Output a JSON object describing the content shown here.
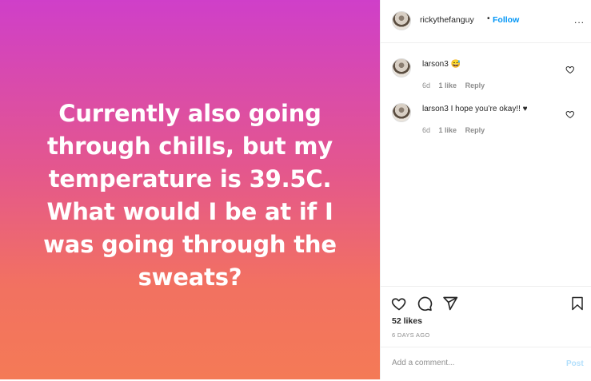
{
  "post": {
    "text": "Currently also going through chills, but my temperature is 39.5C. What would I be at if I was going through the sweats?"
  },
  "header": {
    "username": "rickythefanguy",
    "separator": "•",
    "follow_label": "Follow",
    "more_label": "..."
  },
  "comments": [
    {
      "username": "larson3",
      "text": "😅",
      "age": "6d",
      "likes": "1 like",
      "reply": "Reply"
    },
    {
      "username": "larson3",
      "text": "I hope you’re okay!! ♥",
      "age": "6d",
      "likes": "1 like",
      "reply": "Reply"
    }
  ],
  "actions": {
    "likes": "52 likes",
    "time_ago": "6 DAYS AGO"
  },
  "add_comment": {
    "placeholder": "Add a comment...",
    "post_label": "Post"
  },
  "colors": {
    "follow": "#0095f6",
    "post_disabled": "#b2dffc",
    "gradient_top": "#cf3fc9",
    "gradient_bottom": "#f47a56"
  }
}
